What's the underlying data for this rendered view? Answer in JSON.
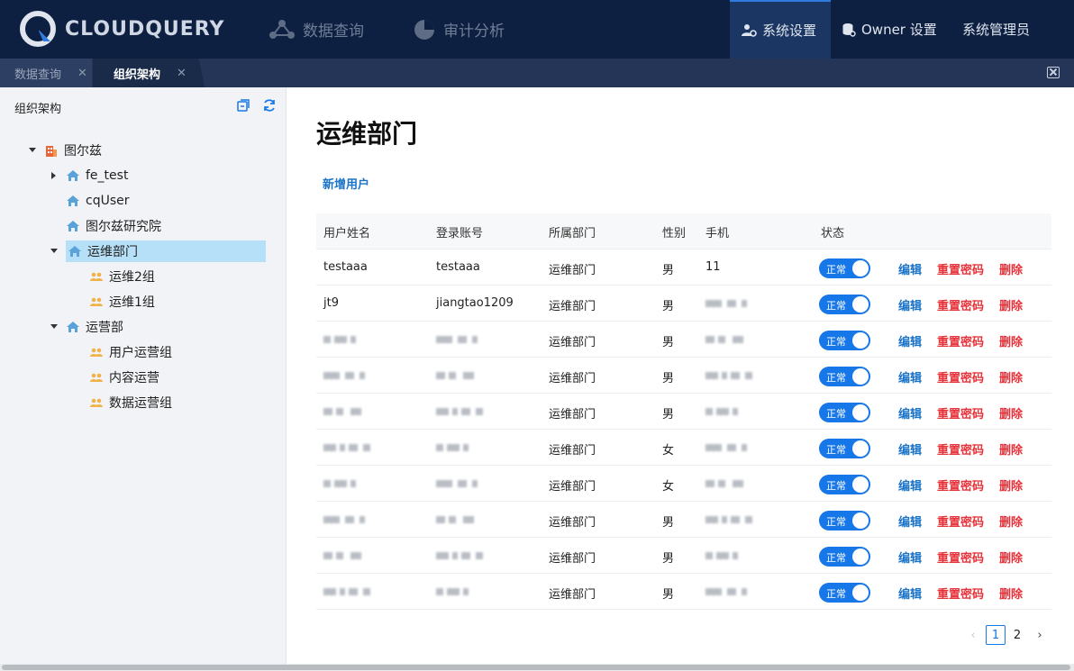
{
  "app": {
    "brand": "CLOUDQUERY"
  },
  "nav": {
    "main": [
      {
        "label": "数据查询",
        "icon": "network-icon"
      },
      {
        "label": "审计分析",
        "icon": "pie-chart-icon"
      }
    ],
    "right": [
      {
        "label": "系统设置",
        "icon": "user-settings-icon",
        "active": true
      },
      {
        "label": "Owner 设置",
        "icon": "database-settings-icon",
        "active": false
      },
      {
        "label": "系统管理员",
        "active": false
      }
    ]
  },
  "tabs": [
    {
      "label": "数据查询",
      "active": false
    },
    {
      "label": "组织架构",
      "active": true
    }
  ],
  "sidebar": {
    "title": "组织架构",
    "tree": [
      {
        "label": "图尔兹",
        "type": "company",
        "expanded": true,
        "level": 0
      },
      {
        "label": "fe_test",
        "type": "dept",
        "expanded": false,
        "level": 1
      },
      {
        "label": "cqUser",
        "type": "dept",
        "level": 1
      },
      {
        "label": "图尔兹研究院",
        "type": "dept",
        "level": 1
      },
      {
        "label": "运维部门",
        "type": "dept",
        "expanded": true,
        "level": 1,
        "selected": true
      },
      {
        "label": "运维2组",
        "type": "group",
        "level": 2
      },
      {
        "label": "运维1组",
        "type": "group",
        "level": 2
      },
      {
        "label": "运营部",
        "type": "dept",
        "expanded": true,
        "level": 1
      },
      {
        "label": "用户运营组",
        "type": "group",
        "level": 2
      },
      {
        "label": "内容运营",
        "type": "group",
        "level": 2
      },
      {
        "label": "数据运营组",
        "type": "group",
        "level": 2
      }
    ]
  },
  "main": {
    "title": "运维部门",
    "add_user": "新增用户",
    "columns": [
      "用户姓名",
      "登录账号",
      "所属部门",
      "性别",
      "手机",
      "状态"
    ],
    "rows": [
      {
        "name": "testaaa",
        "account": "testaaa",
        "dept": "运维部门",
        "gender": "男",
        "phone": "11",
        "status": "正常"
      },
      {
        "name": "jt9",
        "account": "jiangtao1209",
        "dept": "运维部门",
        "gender": "男",
        "phone": "",
        "status": "正常"
      },
      {
        "name": "",
        "account": "",
        "dept": "运维部门",
        "gender": "男",
        "phone": "",
        "status": "正常"
      },
      {
        "name": "",
        "account": "",
        "dept": "运维部门",
        "gender": "男",
        "phone": "",
        "status": "正常"
      },
      {
        "name": "",
        "account": "",
        "dept": "运维部门",
        "gender": "男",
        "phone": "",
        "status": "正常"
      },
      {
        "name": "",
        "account": "",
        "dept": "运维部门",
        "gender": "女",
        "phone": "",
        "status": "正常"
      },
      {
        "name": "",
        "account": "",
        "dept": "运维部门",
        "gender": "女",
        "phone": "",
        "status": "正常"
      },
      {
        "name": "",
        "account": "",
        "dept": "运维部门",
        "gender": "男",
        "phone": "",
        "status": "正常"
      },
      {
        "name": "",
        "account": "",
        "dept": "运维部门",
        "gender": "男",
        "phone": "",
        "status": "正常"
      },
      {
        "name": "",
        "account": "",
        "dept": "运维部门",
        "gender": "男",
        "phone": "",
        "status": "正常"
      }
    ],
    "actions": {
      "edit": "编辑",
      "reset": "重置密码",
      "delete": "删除"
    },
    "pagination": {
      "current": "1",
      "next_page": "2"
    }
  },
  "colors": {
    "topbar": "#0e2041",
    "accent": "#1677e8",
    "danger": "#e8323a",
    "link": "#1a73c7",
    "selected": "#b6e0f7"
  }
}
